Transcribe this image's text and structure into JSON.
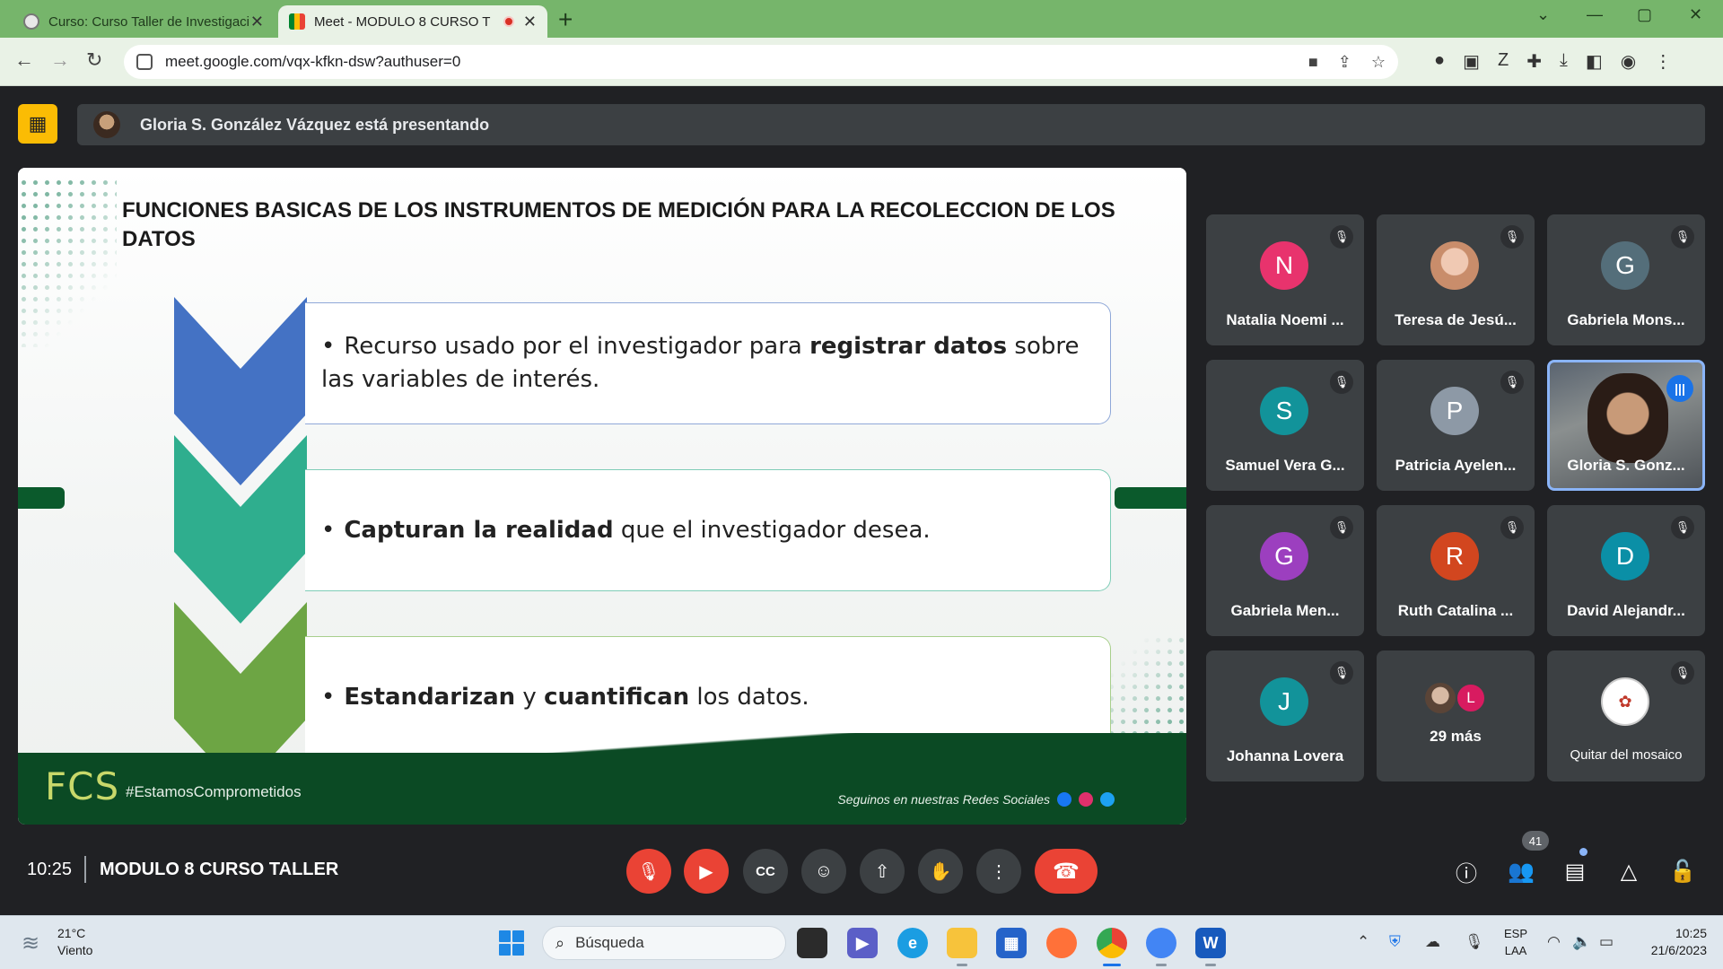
{
  "browser": {
    "tabs": [
      {
        "title": "Curso: Curso Taller de Investigaci",
        "active": false
      },
      {
        "title": "Meet - MODULO 8 CURSO T",
        "active": true
      }
    ],
    "new_tab": "+",
    "url": "meet.google.com/vqx-kfkn-dsw?authuser=0",
    "win_min": "—",
    "win_max": "▢",
    "win_close": "✕",
    "tab_list": "⌄"
  },
  "meet": {
    "presenter_label": "Gloria S. González Vázquez está presentando",
    "slide": {
      "heading": "FUNCIONES  BASICAS DE LOS INSTRUMENTOS DE MEDICIÓN PARA LA RECOLECCION DE LOS DATOS",
      "items": [
        {
          "pre": "Recurso usado por el investigador para ",
          "bold": "registrar datos",
          "post": " sobre las variables de interés.",
          "color": "#4472c4"
        },
        {
          "pre": "",
          "bold": "Capturan la realidad",
          "post": " que el investigador desea.",
          "color": "#2fae8e"
        },
        {
          "pre": "",
          "bold": "Estandarizan",
          "mid": " y ",
          "bold2": "cuantifican",
          "post": " los datos.",
          "color": "#6da544"
        }
      ],
      "footer_logo": "FCS",
      "hashtag": "#EstamosComprometidos",
      "social": "Seguinos en nuestras Redes Sociales"
    },
    "participants": [
      {
        "initial": "N",
        "name": "Natalia Noemi ...",
        "color": "#e8336d"
      },
      {
        "initial": "",
        "name": "Teresa de Jesú...",
        "color": "#d9a38c"
      },
      {
        "initial": "G",
        "name": "Gabriela Mons...",
        "color": "#546e7a"
      },
      {
        "initial": "S",
        "name": "Samuel Vera G...",
        "color": "#12939a"
      },
      {
        "initial": "P",
        "name": "Patricia Ayelen...",
        "color": "#8d99a6"
      },
      {
        "initial": "",
        "name": "Gloria S. Gonz...",
        "color": ""
      },
      {
        "initial": "G",
        "name": "Gabriela Men...",
        "color": "#9c3fbf"
      },
      {
        "initial": "R",
        "name": "Ruth Catalina ...",
        "color": "#d2461f"
      },
      {
        "initial": "D",
        "name": "David Alejandr...",
        "color": "#0b8fa6"
      },
      {
        "initial": "J",
        "name": "Johanna Lovera",
        "color": "#12939a"
      },
      {
        "initial": "L",
        "name": "29 más",
        "color": "#d81b60"
      },
      {
        "initial": "",
        "name": "Quitar del mosaico",
        "color": "#ffffff"
      }
    ],
    "clock": "10:25",
    "meeting_name": "MODULO 8 CURSO TALLER",
    "participant_count": "41"
  },
  "taskbar": {
    "temp": "21°C",
    "weather": "Viento",
    "search_placeholder": "Búsqueda",
    "lang1": "ESP",
    "lang2": "LAA",
    "time": "10:25",
    "date": "21/6/2023"
  }
}
